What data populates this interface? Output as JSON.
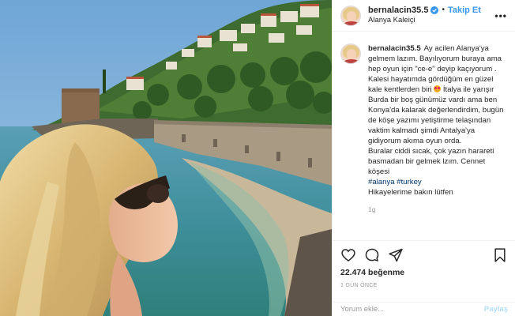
{
  "header": {
    "username": "bernalacin35.5",
    "separator": "•",
    "follow_label": "Takip Et",
    "location": "Alanya Kaleiçi",
    "more": "•••"
  },
  "caption": {
    "username": "bernalacin35.5",
    "part1": "Ay acilen Alanya'ya gelmem lazım. Bayılıyorum buraya ama hep oyun için \"ce-e\" deyip kaçıyorum . Kalesi hayatımda gördüğüm en güzel kale kentlerden biri ",
    "part2": " İtalya ile yarışır\nBurda bir boş günümüz vardı ama ben Konya'da kalarak değerlendirdim, bugün de köşe yazımı yetiştirme telaşından vaktim kalmadı şimdi Antalya'ya gidiyorum akıma oyun orda.\nBuralar ciddi sıcak, çok yazın harareti basmadan bir gelmek lzım. Cennet köşesi",
    "hashtags": "#alanya #turkey",
    "footer": "Hikayelerime bakın lütfen",
    "time": "1g"
  },
  "stats": {
    "likes_count": "22.474",
    "likes_label": "beğenme",
    "time_ago": "1 GÜN ÖNCE"
  },
  "comment": {
    "placeholder": "Yorum ekle...",
    "post_label": "Paylaş"
  },
  "colors": {
    "accent": "#3897f0",
    "post_disabled": "#b2dffc",
    "sky": "#7fb0d6",
    "sea": "#3d8fa0"
  },
  "icons": [
    "heart-icon",
    "comment-icon",
    "share-icon",
    "bookmark-icon",
    "verified-icon",
    "more-icon"
  ]
}
